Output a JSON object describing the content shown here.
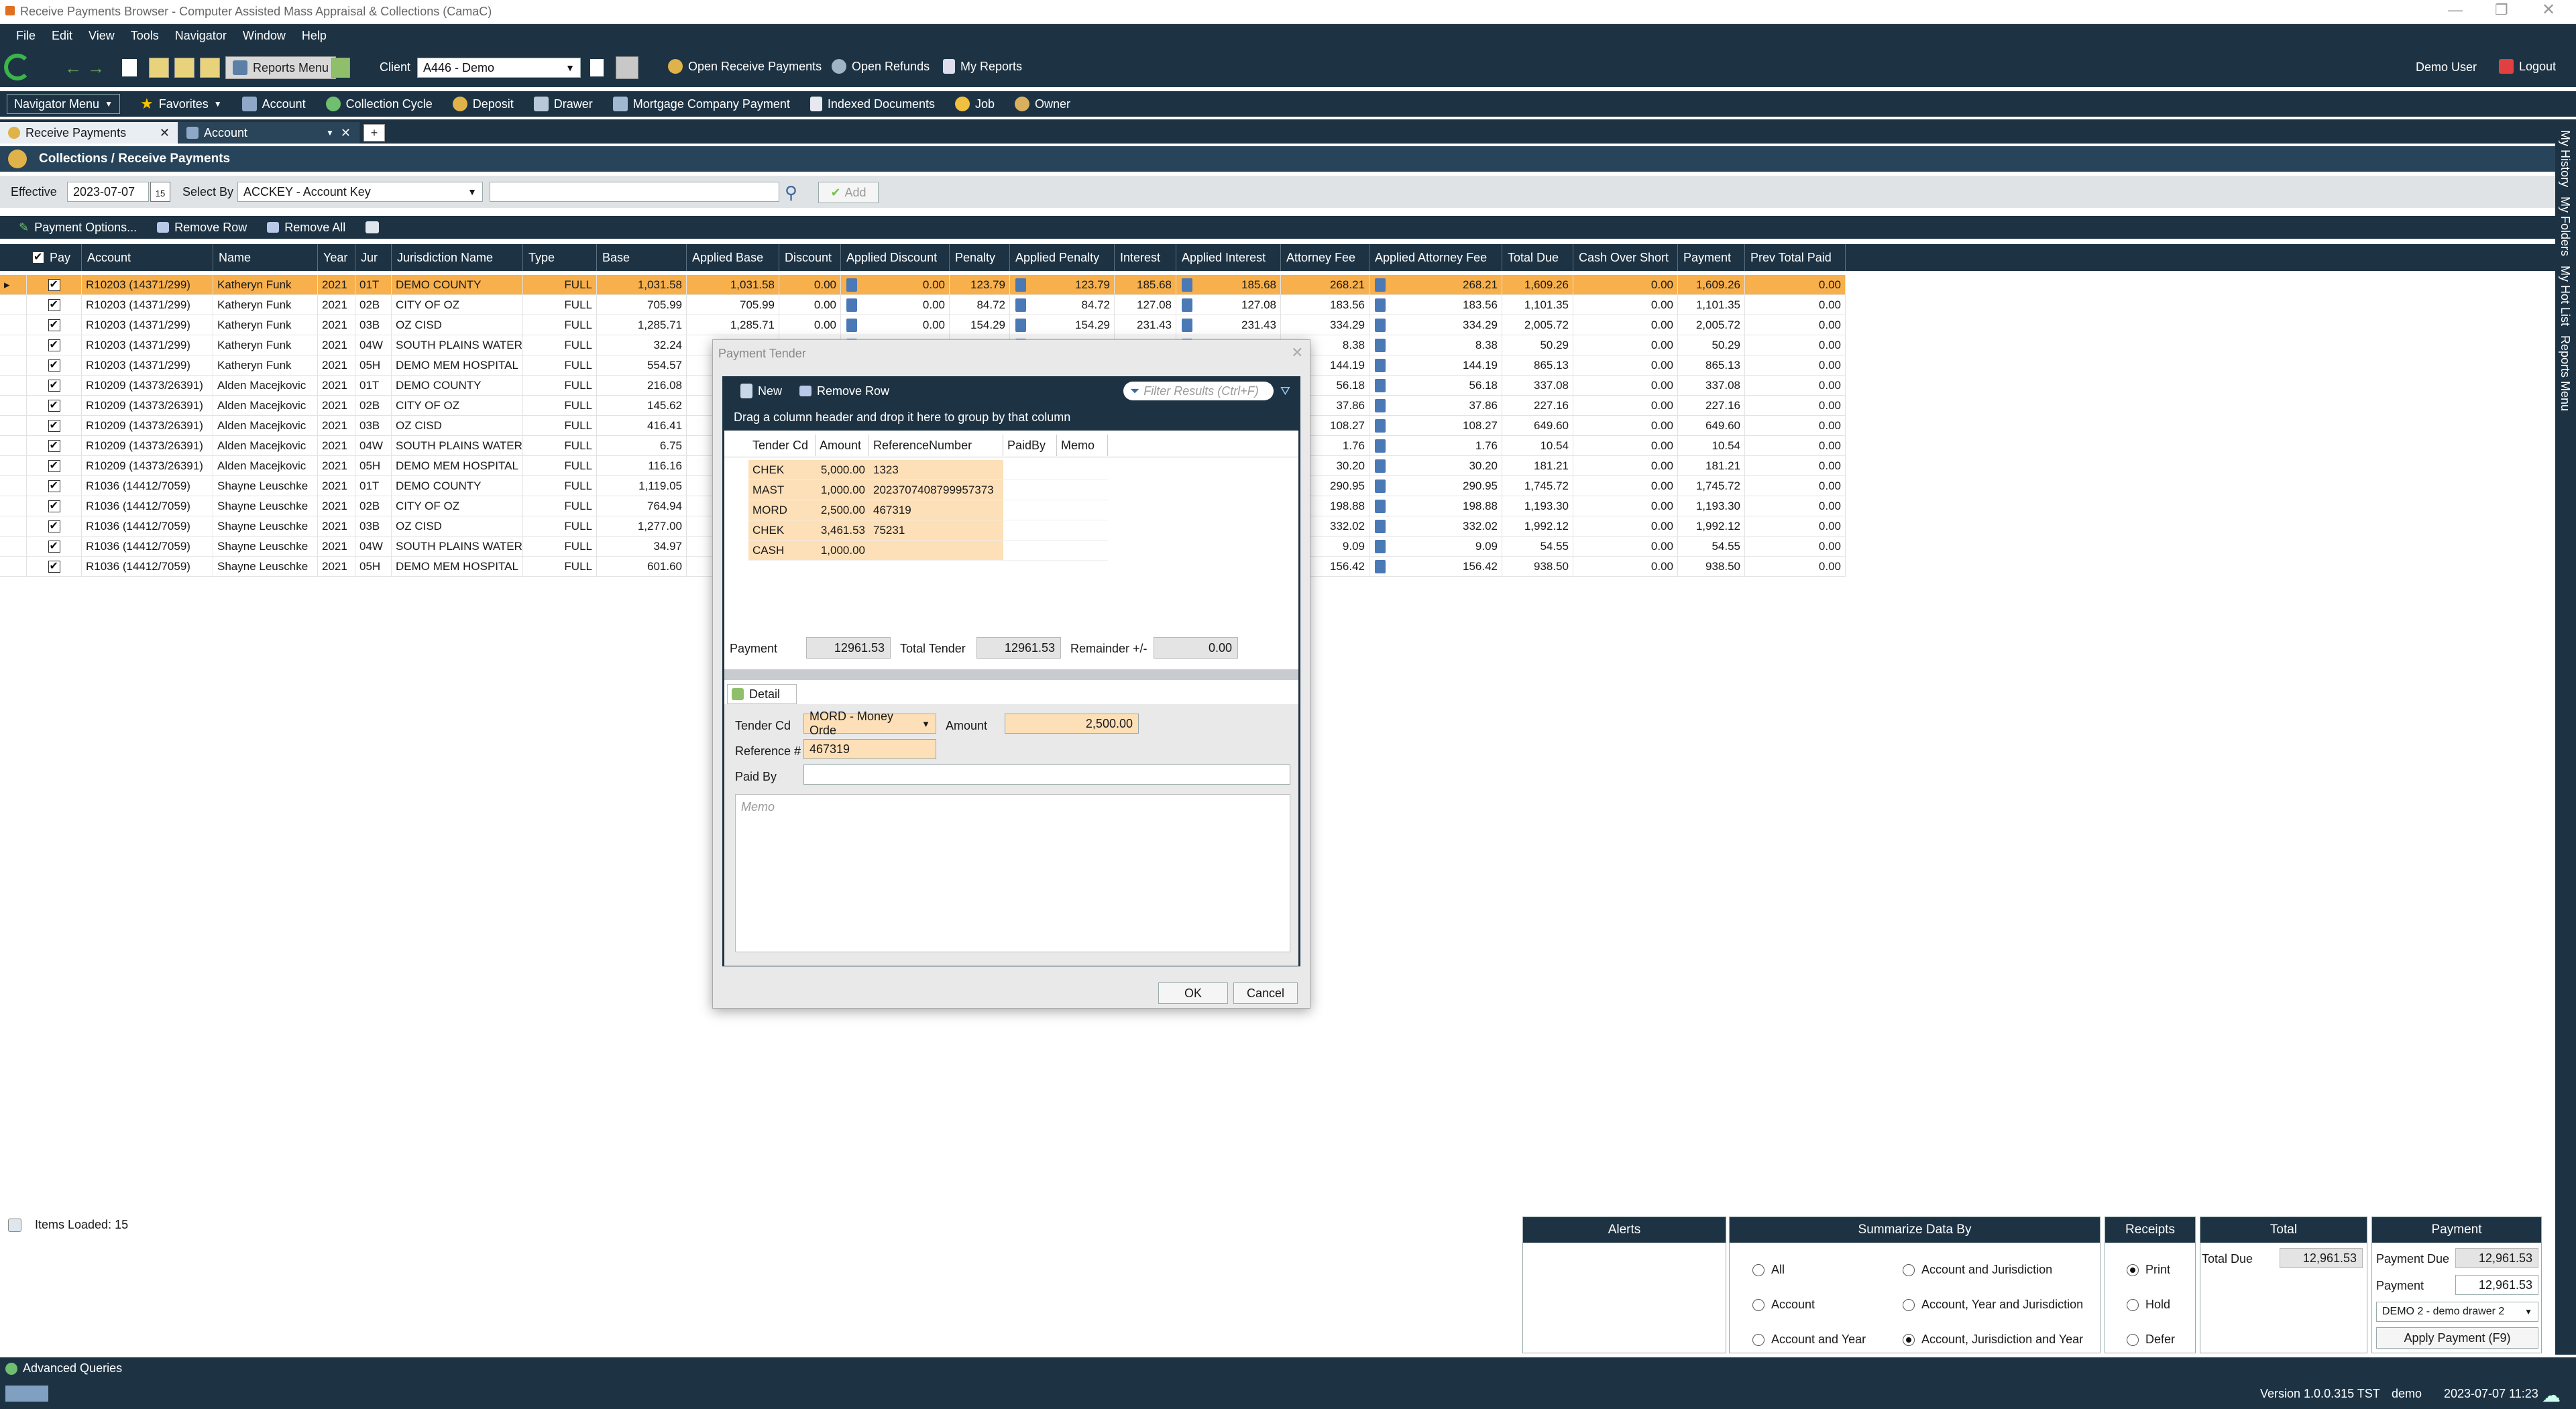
{
  "window": {
    "title": "Receive Payments Browser - Computer Assisted Mass Appraisal & Collections (CamaC)"
  },
  "menu": [
    "File",
    "Edit",
    "View",
    "Tools",
    "Navigator",
    "Window",
    "Help"
  ],
  "toolbar": {
    "reports_menu": "Reports Menu",
    "client_label": "Client",
    "client_value": "A446 - Demo",
    "open_receive_payments": "Open Receive Payments",
    "open_refunds": "Open Refunds",
    "my_reports": "My Reports",
    "user": "Demo User",
    "logout": "Logout"
  },
  "nav": {
    "navigator_menu": "Navigator Menu",
    "favorites": "Favorites",
    "items": [
      "Account",
      "Collection Cycle",
      "Deposit",
      "Drawer",
      "Mortgage Company Payment",
      "Indexed Documents",
      "Job",
      "Owner"
    ]
  },
  "tabs": [
    {
      "label": "Receive Payments"
    },
    {
      "label": "Account"
    }
  ],
  "panel": {
    "title": "Collections / Receive Payments"
  },
  "filter": {
    "effective_label": "Effective",
    "effective_value": "2023-07-07",
    "calendar_day": "15",
    "select_by_label": "Select By",
    "select_by_value": "ACCKEY - Account Key",
    "search_value": "",
    "add_label": "Add"
  },
  "gridbar": {
    "payment_options": "Payment Options...",
    "remove_row": "Remove Row",
    "remove_all": "Remove All"
  },
  "grid": {
    "headers": [
      "Pay",
      "Account",
      "Name",
      "Year",
      "Jur",
      "Jurisdiction Name",
      "Type",
      "Base",
      "Applied Base",
      "Discount",
      "Applied Discount",
      "Penalty",
      "Applied Penalty",
      "Interest",
      "Applied Interest",
      "Attorney Fee",
      "Applied Attorney Fee",
      "Total Due",
      "Cash Over Short",
      "Payment",
      "Prev Total Paid"
    ],
    "rows": [
      [
        "R10203 (14371/299)",
        "Katheryn Funk",
        "2021",
        "01T",
        "DEMO COUNTY",
        "FULL",
        "1,031.58",
        "1,031.58",
        "0.00",
        "0.00",
        "123.79",
        "123.79",
        "185.68",
        "185.68",
        "268.21",
        "268.21",
        "1,609.26",
        "0.00",
        "1,609.26",
        "0.00"
      ],
      [
        "R10203 (14371/299)",
        "Katheryn Funk",
        "2021",
        "02B",
        "CITY OF OZ",
        "FULL",
        "705.99",
        "705.99",
        "0.00",
        "0.00",
        "84.72",
        "84.72",
        "127.08",
        "127.08",
        "183.56",
        "183.56",
        "1,101.35",
        "0.00",
        "1,101.35",
        "0.00"
      ],
      [
        "R10203 (14371/299)",
        "Katheryn Funk",
        "2021",
        "03B",
        "OZ CISD",
        "FULL",
        "1,285.71",
        "1,285.71",
        "0.00",
        "0.00",
        "154.29",
        "154.29",
        "231.43",
        "231.43",
        "334.29",
        "334.29",
        "2,005.72",
        "0.00",
        "2,005.72",
        "0.00"
      ],
      [
        "R10203 (14371/299)",
        "Katheryn Funk",
        "2021",
        "04W",
        "SOUTH PLAINS WATER",
        "FULL",
        "32.24",
        "",
        "",
        "",
        "",
        "",
        "",
        "",
        "8.38",
        "8.38",
        "50.29",
        "0.00",
        "50.29",
        "0.00"
      ],
      [
        "R10203 (14371/299)",
        "Katheryn Funk",
        "2021",
        "05H",
        "DEMO MEM HOSPITAL",
        "FULL",
        "554.57",
        "",
        "",
        "",
        "",
        "",
        "",
        "",
        "144.19",
        "144.19",
        "865.13",
        "0.00",
        "865.13",
        "0.00"
      ],
      [
        "R10209 (14373/26391)",
        "Alden Macejkovic",
        "2021",
        "01T",
        "DEMO COUNTY",
        "FULL",
        "216.08",
        "",
        "",
        "",
        "",
        "",
        "",
        "",
        "56.18",
        "56.18",
        "337.08",
        "0.00",
        "337.08",
        "0.00"
      ],
      [
        "R10209 (14373/26391)",
        "Alden Macejkovic",
        "2021",
        "02B",
        "CITY OF OZ",
        "FULL",
        "145.62",
        "",
        "",
        "",
        "",
        "",
        "",
        "",
        "37.86",
        "37.86",
        "227.16",
        "0.00",
        "227.16",
        "0.00"
      ],
      [
        "R10209 (14373/26391)",
        "Alden Macejkovic",
        "2021",
        "03B",
        "OZ CISD",
        "FULL",
        "416.41",
        "",
        "",
        "",
        "",
        "",
        "",
        "",
        "108.27",
        "108.27",
        "649.60",
        "0.00",
        "649.60",
        "0.00"
      ],
      [
        "R10209 (14373/26391)",
        "Alden Macejkovic",
        "2021",
        "04W",
        "SOUTH PLAINS WATER",
        "FULL",
        "6.75",
        "",
        "",
        "",
        "",
        "",
        "",
        "",
        "1.76",
        "1.76",
        "10.54",
        "0.00",
        "10.54",
        "0.00"
      ],
      [
        "R10209 (14373/26391)",
        "Alden Macejkovic",
        "2021",
        "05H",
        "DEMO MEM HOSPITAL",
        "FULL",
        "116.16",
        "",
        "",
        "",
        "",
        "",
        "",
        "",
        "30.20",
        "30.20",
        "181.21",
        "0.00",
        "181.21",
        "0.00"
      ],
      [
        "R1036 (14412/7059)",
        "Shayne Leuschke",
        "2021",
        "01T",
        "DEMO COUNTY",
        "FULL",
        "1,119.05",
        "",
        "",
        "",
        "",
        "",
        "",
        "",
        "290.95",
        "290.95",
        "1,745.72",
        "0.00",
        "1,745.72",
        "0.00"
      ],
      [
        "R1036 (14412/7059)",
        "Shayne Leuschke",
        "2021",
        "02B",
        "CITY OF OZ",
        "FULL",
        "764.94",
        "",
        "",
        "",
        "",
        "",
        "",
        "",
        "198.88",
        "198.88",
        "1,193.30",
        "0.00",
        "1,193.30",
        "0.00"
      ],
      [
        "R1036 (14412/7059)",
        "Shayne Leuschke",
        "2021",
        "03B",
        "OZ CISD",
        "FULL",
        "1,277.00",
        "",
        "",
        "",
        "",
        "",
        "",
        "",
        "332.02",
        "332.02",
        "1,992.12",
        "0.00",
        "1,992.12",
        "0.00"
      ],
      [
        "R1036 (14412/7059)",
        "Shayne Leuschke",
        "2021",
        "04W",
        "SOUTH PLAINS WATER",
        "FULL",
        "34.97",
        "",
        "",
        "",
        "",
        "",
        "",
        "",
        "9.09",
        "9.09",
        "54.55",
        "0.00",
        "54.55",
        "0.00"
      ],
      [
        "R1036 (14412/7059)",
        "Shayne Leuschke",
        "2021",
        "05H",
        "DEMO MEM HOSPITAL",
        "FULL",
        "601.60",
        "",
        "",
        "",
        "",
        "",
        "",
        "",
        "156.42",
        "156.42",
        "938.50",
        "0.00",
        "938.50",
        "0.00"
      ]
    ]
  },
  "dialog": {
    "title": "Payment Tender",
    "new_label": "New",
    "remove_row": "Remove Row",
    "filter_placeholder": "Filter Results (Ctrl+F)",
    "group_hint": "Drag a column header and drop it here to group by that column",
    "headers": [
      "Tender Cd",
      "Amount",
      "ReferenceNumber",
      "PaidBy",
      "Memo"
    ],
    "rows": [
      [
        "CHEK",
        "5,000.00",
        "1323"
      ],
      [
        "MAST",
        "1,000.00",
        "2023707408799957373"
      ],
      [
        "MORD",
        "2,500.00",
        "467319"
      ],
      [
        "CHEK",
        "3,461.53",
        "75231"
      ],
      [
        "CASH",
        "1,000.00",
        ""
      ]
    ],
    "payment_label": "Payment",
    "payment_value": "12961.53",
    "total_tender_label": "Total Tender",
    "total_tender_value": "12961.53",
    "remainder_label": "Remainder +/-",
    "remainder_value": "0.00",
    "detail_tab": "Detail",
    "tender_cd_label": "Tender Cd",
    "tender_cd_value": "MORD - Money Orde",
    "amount_label": "Amount",
    "amount_value": "2,500.00",
    "reference_label": "Reference #",
    "reference_value": "467319",
    "paid_by_label": "Paid By",
    "paid_by_value": "",
    "memo_placeholder": "Memo",
    "ok": "OK",
    "cancel": "Cancel"
  },
  "footer": {
    "items_loaded": "Items Loaded:  15",
    "alerts": "Alerts",
    "summarize_title": "Summarize Data By",
    "summarize_options": [
      "All",
      "Account",
      "Account and Year",
      "Account and Jurisdiction",
      "Account, Year and Jurisdiction",
      "Account, Jurisdiction and Year"
    ],
    "receipts_title": "Receipts",
    "receipts_options": [
      "Print",
      "Hold",
      "Defer"
    ],
    "total_title": "Total",
    "total_due_label": "Total Due",
    "total_due_value": "12,961.53",
    "payment_title": "Payment",
    "payment_due_label": "Payment Due",
    "payment_due_value": "12,961.53",
    "payment_label": "Payment",
    "payment_value": "12,961.53",
    "drawer_value": "DEMO 2 - demo drawer 2",
    "apply_label": "Apply Payment (F9)"
  },
  "status": {
    "advanced_queries": "Advanced Queries",
    "version": "Version 1.0.0.315 TST",
    "user": "demo",
    "datetime": "2023-07-07  11:23"
  },
  "right_rail": [
    "My History",
    "My Folders",
    "My Hot List",
    "Reports Menu"
  ],
  "colors": {
    "dark": "#1d3344",
    "selected_row": "#f7b04c",
    "peach": "#fde0b8"
  }
}
